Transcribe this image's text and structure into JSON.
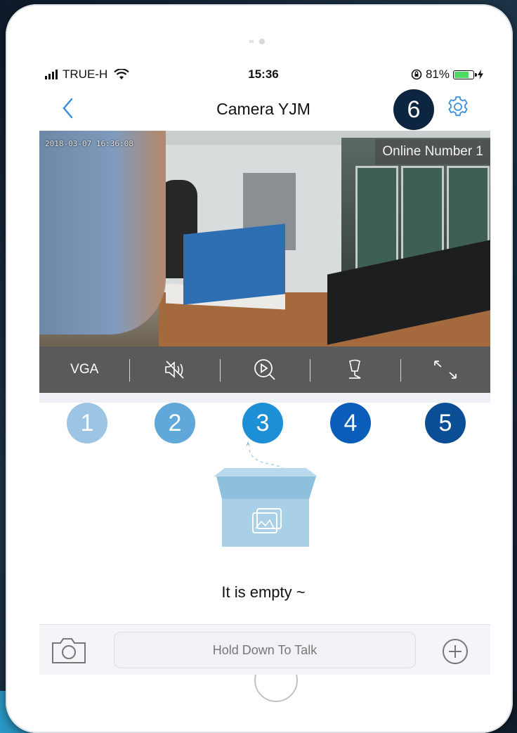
{
  "status_bar": {
    "carrier": "TRUE-H",
    "time": "15:36",
    "battery_percent": "81%",
    "battery_level": 0.81
  },
  "header": {
    "title": "Camera YJM",
    "back_icon": "chevron-left-icon",
    "settings_icon": "gear-icon"
  },
  "video": {
    "timestamp": "2018-03-07 16:36:08",
    "online_label": "Online Number 1"
  },
  "controls": {
    "quality_label": "VGA",
    "items": [
      "quality",
      "mute-speaker-icon",
      "playback-search-icon",
      "microphone-icon",
      "fullscreen-icon"
    ]
  },
  "badges": [
    "1",
    "2",
    "3",
    "4",
    "5",
    "6"
  ],
  "badge_colors": [
    "#9cc5e3",
    "#5fa8d9",
    "#1c8fd6",
    "#0a5db8",
    "#0a4f95",
    "#0c2540"
  ],
  "empty_state": {
    "message": "It is empty ~"
  },
  "bottom_bar": {
    "talk_label": "Hold Down To Talk",
    "camera_icon": "camera-icon",
    "plus_icon": "plus-circle-icon"
  },
  "colors": {
    "accent": "#3b8fe0",
    "control_bar": "#5a5a5a"
  }
}
